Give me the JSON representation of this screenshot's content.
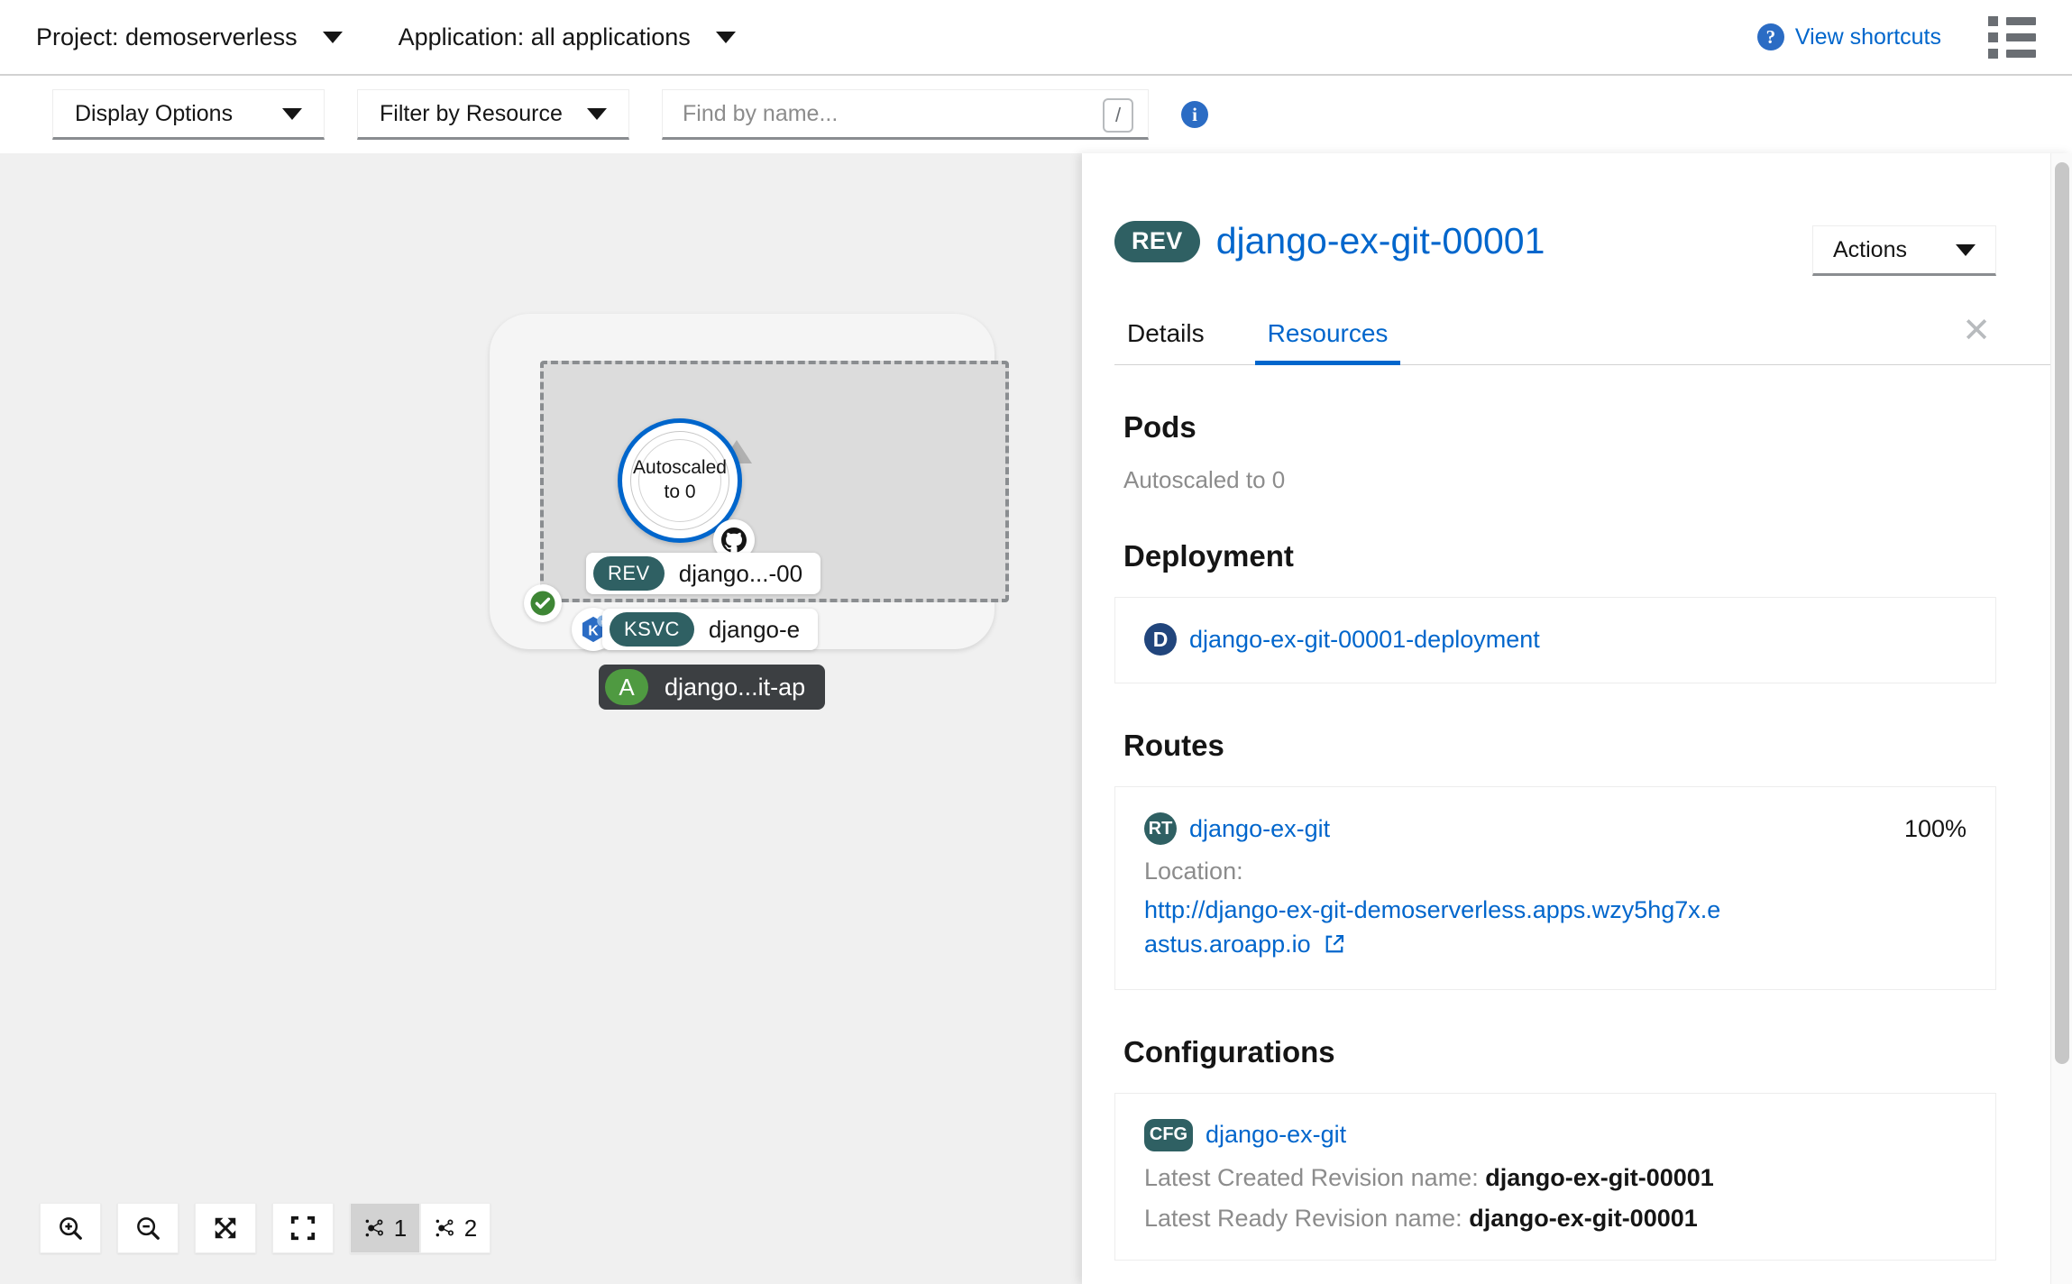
{
  "topbar": {
    "project_label": "Project: demoserverless",
    "application_label": "Application: all applications",
    "shortcuts_label": "View shortcuts",
    "help_glyph": "?",
    "list_view_icon": "list-view-icon"
  },
  "toolbar": {
    "display_options_label": "Display Options",
    "filter_by_resource_label": "Filter by Resource",
    "search_placeholder": "Find by name...",
    "search_value": "",
    "slash_hint": "/",
    "info_glyph": "i"
  },
  "topology": {
    "revision_circle_line1": "Autoscaled",
    "revision_circle_line2": "to 0",
    "revision_pill_badge": "REV",
    "revision_pill_label": "django...-00",
    "service_pill_badge": "KSVC",
    "service_pill_label": "django-e",
    "app_pill_badge": "A",
    "app_pill_label": "django...it-ap",
    "source_icon": "github-icon",
    "knative_icon": "knative-icon",
    "status_icon": "check-circle-icon"
  },
  "graph_tools": {
    "zoom_in": "zoom-in",
    "zoom_out": "zoom-out",
    "fit_to_screen": "fit-to-screen",
    "reset_view": "reset-view",
    "layout_1_label": "1",
    "layout_2_label": "2"
  },
  "panel": {
    "close_glyph": "✕",
    "resource_badge": "REV",
    "resource_name": "django-ex-git-00001",
    "actions_label": "Actions",
    "tabs": [
      {
        "label": "Details",
        "active": false
      },
      {
        "label": "Resources",
        "active": true
      }
    ],
    "pods": {
      "title": "Pods",
      "status": "Autoscaled to 0"
    },
    "deployment": {
      "title": "Deployment",
      "icon_letter": "D",
      "name": "django-ex-git-00001-deployment"
    },
    "routes": {
      "title": "Routes",
      "icon_letter": "RT",
      "name": "django-ex-git",
      "percent": "100%",
      "location_label": "Location:",
      "url": "http://django-ex-git-demoserverless.apps.wzy5hg7x.eastus.aroapp.io"
    },
    "configurations": {
      "title": "Configurations",
      "icon_letter": "CFG",
      "name": "django-ex-git",
      "latest_created_label": "Latest Created Revision name:",
      "latest_created_value": "django-ex-git-00001",
      "latest_ready_label": "Latest Ready Revision name:",
      "latest_ready_value": "django-ex-git-00001"
    }
  },
  "colors": {
    "link_blue": "#0066cc",
    "badge_teal": "#2f6063",
    "deployment_blue": "#21457c",
    "accent_ring": "#0066cc",
    "app_green": "#4f9a41",
    "canvas_bg": "#f0f0f0"
  }
}
